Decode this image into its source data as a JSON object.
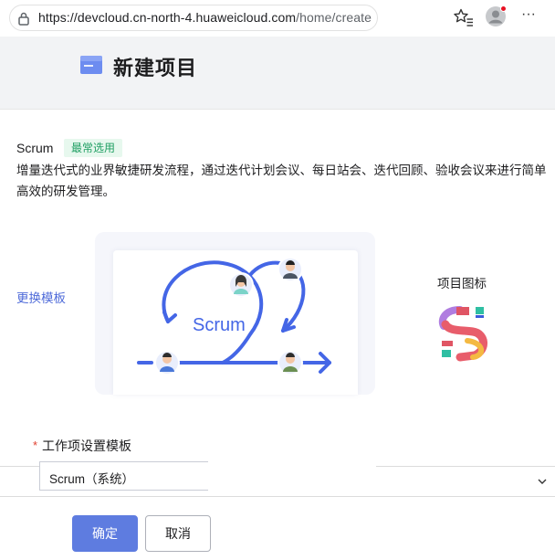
{
  "browser": {
    "url_host": "https://devcloud.cn-north-4.huaweicloud.com",
    "url_path": "/home/create",
    "more_glyph": "···"
  },
  "header": {
    "title": "新建项目"
  },
  "template": {
    "name": "Scrum",
    "badge": "最常选用",
    "description": "增量迭代式的业界敏捷研发流程，通过迭代计划会议、每日站会、迭代回顾、验收会议来进行简单高效的研发管理。",
    "change_label": "更换模板",
    "preview_text": "Scrum"
  },
  "project_icon": {
    "label": "项目图标"
  },
  "form": {
    "required_mark": "*",
    "field_label": "工作项设置模板",
    "select_value": "Scrum（系统）"
  },
  "actions": {
    "confirm": "确定",
    "cancel": "取消"
  },
  "colors": {
    "accent": "#5e7ce0",
    "flow_blue": "#4466e6",
    "badge_green": "#1f9e62",
    "required_red": "#e03e2d"
  }
}
